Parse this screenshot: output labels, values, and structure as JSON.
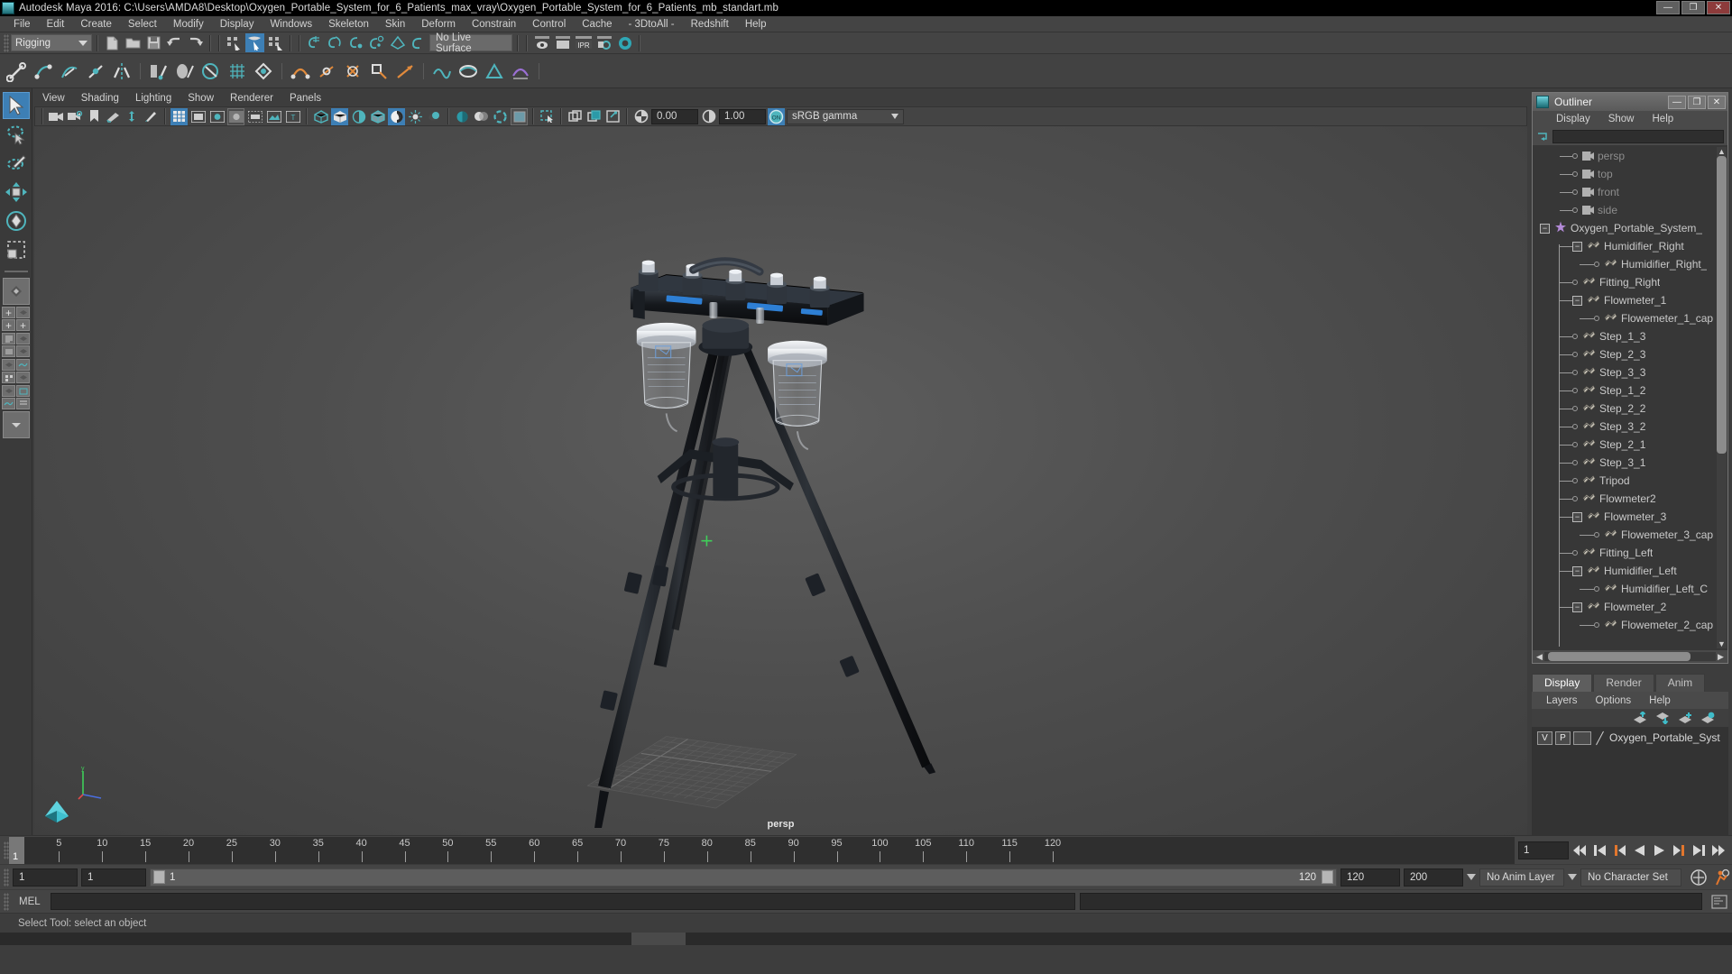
{
  "window": {
    "title": "Autodesk Maya 2016: C:\\Users\\AMDA8\\Desktop\\Oxygen_Portable_System_for_6_Patients_max_vray\\Oxygen_Portable_System_for_6_Patients_mb_standart.mb",
    "minimize": "—",
    "maximize": "❐",
    "close": "✕"
  },
  "menubar": {
    "items": [
      "File",
      "Edit",
      "Create",
      "Select",
      "Modify",
      "Display",
      "Windows",
      "Skeleton",
      "Skin",
      "Deform",
      "Constrain",
      "Control",
      "Cache",
      "- 3DtoAll -",
      "Redshift",
      "Help"
    ]
  },
  "statusline": {
    "menuset": "Rigging",
    "live_surface": "No Live Surface",
    "icons": [
      "new-scene-icon",
      "open-scene-icon",
      "save-scene-icon",
      "undo-icon",
      "redo-icon",
      "select-by-hierarchy-icon",
      "select-by-object-icon",
      "select-by-component-icon",
      "snap-to-grid-icon",
      "snap-to-curve-icon",
      "snap-to-point-icon",
      "snap-to-projected-center-icon",
      "snap-to-view-plane-icon",
      "make-live-icon",
      "render-view-icon",
      "render-region-icon",
      "ipr-render-icon",
      "render-settings-icon",
      "hypershade-icon"
    ],
    "ipr_label": "IPR"
  },
  "viewport": {
    "menus": [
      "View",
      "Shading",
      "Lighting",
      "Show",
      "Renderer",
      "Panels"
    ],
    "camera_label": "persp",
    "exposure": "0.00",
    "gamma": "1.00",
    "color_management": "sRGB gamma",
    "view_gate_label": "ON",
    "tool_icons": [
      "select-camera-icon",
      "camera-attributes-icon",
      "bookmark-icon",
      "image-plane-icon",
      "two-d-pan-zoom-icon",
      "grease-pencil-icon",
      "grid-toggle-icon",
      "film-gate-icon",
      "resolution-gate-icon",
      "gate-mask-icon",
      "film-origin-icon",
      "safe-action-icon",
      "texture-border-icon",
      "wireframe-shading-icon",
      "smooth-shade-all-icon",
      "shade-flat-icon",
      "wireframe-on-shaded-icon",
      "textured-shading-icon",
      "use-default-light-icon",
      "shadows-icon",
      "screen-space-ao-icon",
      "motion-blur-icon",
      "multisample-icon",
      "depth-of-field-icon",
      "isolate-select-icon",
      "xray-icon",
      "xray-joints-icon",
      "xray-active-components-icon",
      "exposure-icon",
      "gamma-icon"
    ]
  },
  "toolbox": {
    "tools": [
      {
        "name": "select-tool",
        "selected": true
      },
      {
        "name": "lasso-select-tool",
        "selected": false
      },
      {
        "name": "paint-select-tool",
        "selected": false
      },
      {
        "name": "move-tool",
        "selected": false
      },
      {
        "name": "rotate-tool",
        "selected": false
      },
      {
        "name": "scale-tool",
        "selected": false
      }
    ],
    "layouts": [
      "single-perspective-layout",
      "four-view-layout",
      "persp-outliner-layout",
      "persp-graph-layout",
      "persp-hypershade-layout",
      "persp-multi-layout",
      "more-layouts"
    ]
  },
  "outliner": {
    "title": "Outliner",
    "menus": [
      "Display",
      "Show",
      "Help"
    ],
    "items": [
      {
        "label": "persp",
        "type": "camera",
        "depth": 1,
        "expander": null
      },
      {
        "label": "top",
        "type": "camera",
        "depth": 1,
        "expander": null
      },
      {
        "label": "front",
        "type": "camera",
        "depth": 1,
        "expander": null
      },
      {
        "label": "side",
        "type": "camera",
        "depth": 1,
        "expander": null
      },
      {
        "label": "Oxygen_Portable_System_",
        "type": "group",
        "depth": 0,
        "expander": "minus"
      },
      {
        "label": "Humidifier_Right",
        "type": "mesh",
        "depth": 1,
        "expander": "minus"
      },
      {
        "label": "Humidifier_Right_",
        "type": "mesh",
        "depth": 2,
        "expander": null
      },
      {
        "label": "Fitting_Right",
        "type": "mesh",
        "depth": 1,
        "expander": null
      },
      {
        "label": "Flowmeter_1",
        "type": "mesh",
        "depth": 1,
        "expander": "minus"
      },
      {
        "label": "Flowemeter_1_cap",
        "type": "mesh",
        "depth": 2,
        "expander": null
      },
      {
        "label": "Step_1_3",
        "type": "mesh",
        "depth": 1,
        "expander": null
      },
      {
        "label": "Step_2_3",
        "type": "mesh",
        "depth": 1,
        "expander": null
      },
      {
        "label": "Step_3_3",
        "type": "mesh",
        "depth": 1,
        "expander": null
      },
      {
        "label": "Step_1_2",
        "type": "mesh",
        "depth": 1,
        "expander": null
      },
      {
        "label": "Step_2_2",
        "type": "mesh",
        "depth": 1,
        "expander": null
      },
      {
        "label": "Step_3_2",
        "type": "mesh",
        "depth": 1,
        "expander": null
      },
      {
        "label": "Step_2_1",
        "type": "mesh",
        "depth": 1,
        "expander": null
      },
      {
        "label": "Step_3_1",
        "type": "mesh",
        "depth": 1,
        "expander": null
      },
      {
        "label": "Tripod",
        "type": "mesh",
        "depth": 1,
        "expander": null
      },
      {
        "label": "Flowmeter2",
        "type": "mesh",
        "depth": 1,
        "expander": null
      },
      {
        "label": "Flowmeter_3",
        "type": "mesh",
        "depth": 1,
        "expander": "minus"
      },
      {
        "label": "Flowemeter_3_cap",
        "type": "mesh",
        "depth": 2,
        "expander": null
      },
      {
        "label": "Fitting_Left",
        "type": "mesh",
        "depth": 1,
        "expander": null
      },
      {
        "label": "Humidifier_Left",
        "type": "mesh",
        "depth": 1,
        "expander": "minus"
      },
      {
        "label": "Humidifier_Left_C",
        "type": "mesh",
        "depth": 2,
        "expander": null
      },
      {
        "label": "Flowmeter_2",
        "type": "mesh",
        "depth": 1,
        "expander": "minus"
      },
      {
        "label": "Flowemeter_2_cap",
        "type": "mesh",
        "depth": 2,
        "expander": null
      }
    ]
  },
  "layer_editor": {
    "tabs": [
      {
        "label": "Display",
        "active": true
      },
      {
        "label": "Render",
        "active": false
      },
      {
        "label": "Anim",
        "active": false
      }
    ],
    "menus": [
      "Layers",
      "Options",
      "Help"
    ],
    "icon_buttons": [
      "move-layer-up-icon",
      "move-layer-down-icon",
      "create-empty-layer-icon",
      "create-layer-from-selected-icon"
    ],
    "rows": [
      {
        "visibility": "V",
        "playback": "P",
        "state": "",
        "name": "Oxygen_Portable_Syst"
      }
    ]
  },
  "timeline": {
    "start": 1,
    "end": 120,
    "current_frame": "1",
    "tick_labels": [
      5,
      10,
      15,
      20,
      25,
      30,
      35,
      40,
      45,
      50,
      55,
      60,
      65,
      70,
      75,
      80,
      85,
      90,
      95,
      100,
      105,
      110,
      115,
      120
    ],
    "playback_buttons": [
      "go-to-start-icon",
      "step-back-frame-icon",
      "step-back-key-icon",
      "play-backwards-icon",
      "play-forwards-icon",
      "step-forward-key-icon",
      "step-forward-frame-icon",
      "go-to-end-icon"
    ]
  },
  "range": {
    "anim_start": "1",
    "anim_end": "1",
    "range_start_label": "1",
    "range_end_label": "120",
    "playback_end": "120",
    "anim_total_end": "200",
    "anim_layer": "No Anim Layer",
    "character_set": "No Character Set",
    "icons": [
      "auto-key-icon",
      "animation-preferences-icon"
    ]
  },
  "command_line": {
    "language": "MEL",
    "input_value": "",
    "output_value": ""
  },
  "status": {
    "help_text": "Select Tool: select an object"
  },
  "colors": {
    "accent": "#3d7fb5",
    "teal": "#3fa9b5",
    "orange": "#e2762d",
    "panel_bg": "#3d3d3d",
    "tree_bg": "#373737"
  }
}
